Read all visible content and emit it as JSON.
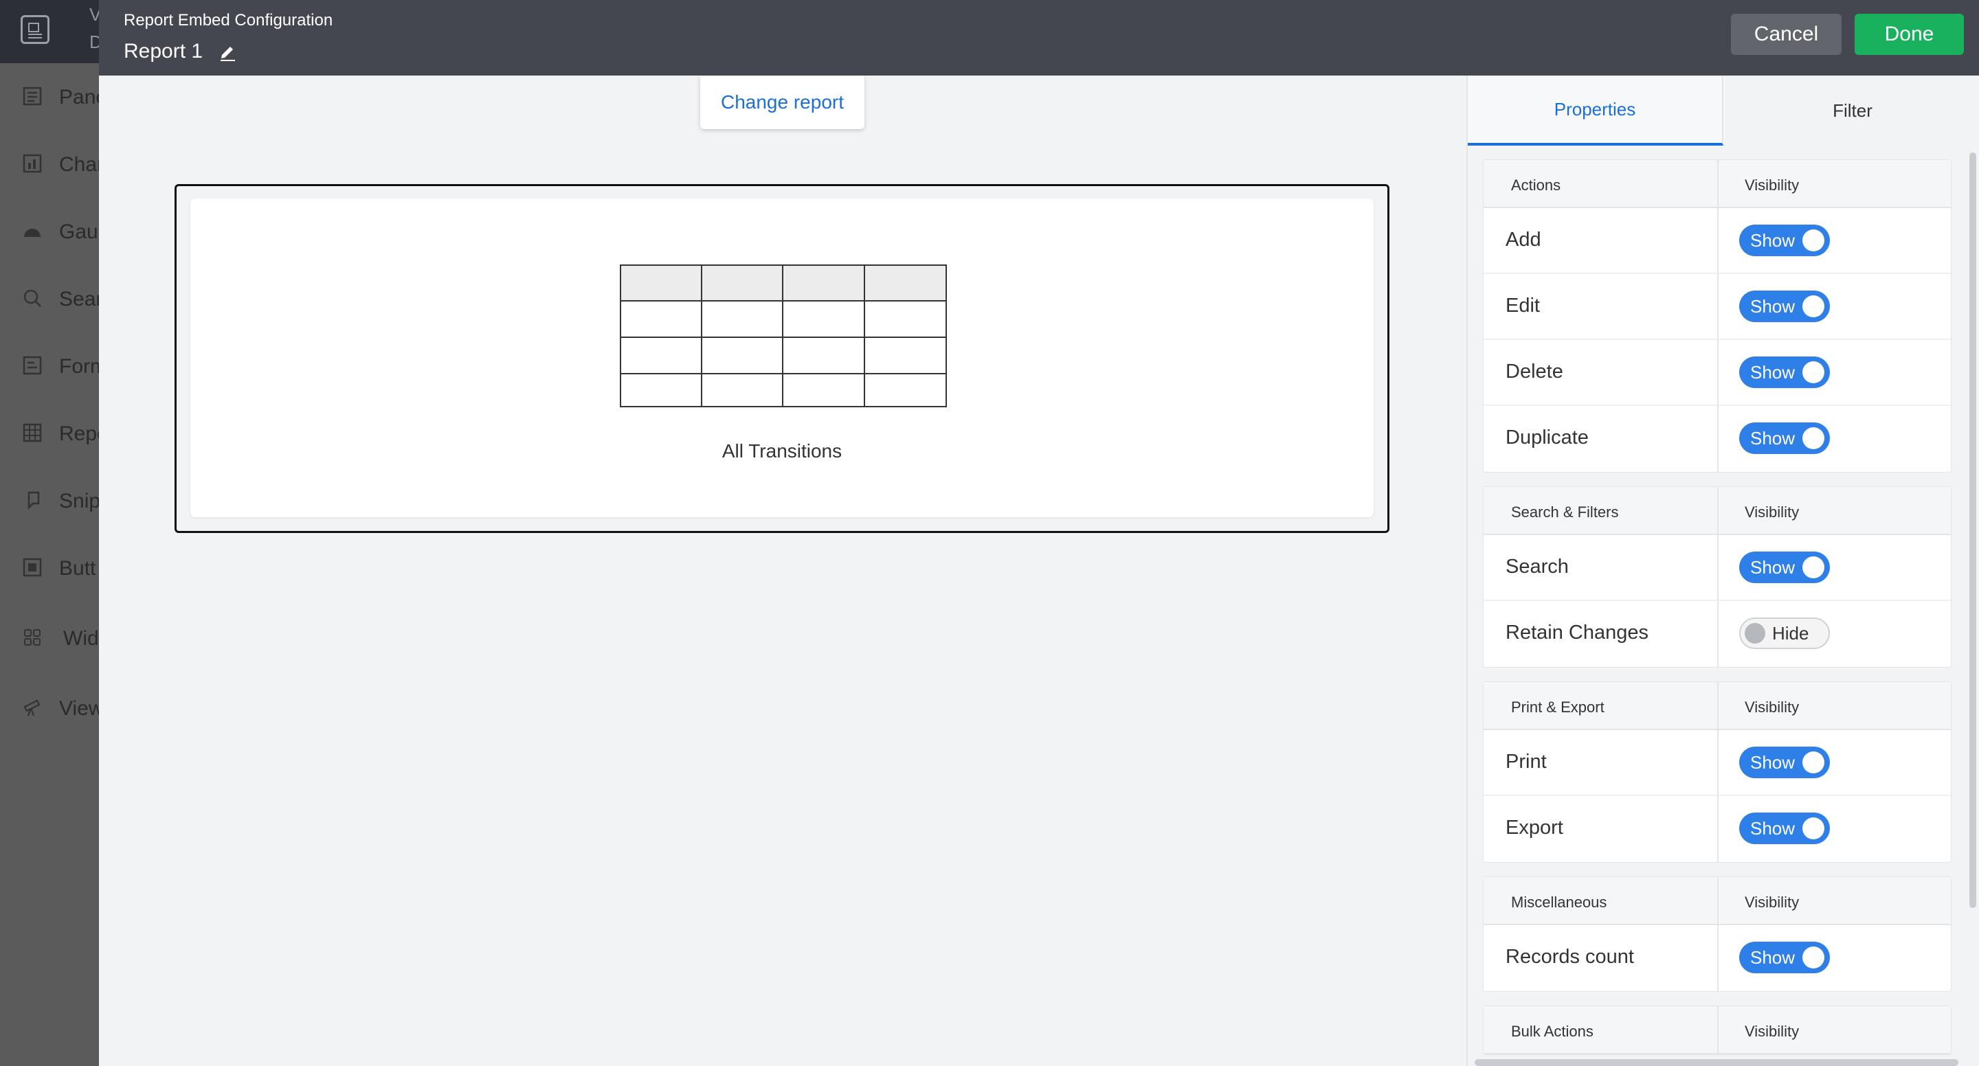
{
  "header": {
    "subtitle": "Report Embed Configuration",
    "title": "Report 1",
    "cancel_label": "Cancel",
    "done_label": "Done"
  },
  "left_sidebar": {
    "top_chars": [
      "V",
      "D"
    ],
    "items": [
      {
        "label": "Pane",
        "icon": "panel-icon"
      },
      {
        "label": "Char",
        "icon": "chart-icon"
      },
      {
        "label": "Gau",
        "icon": "gauge-icon"
      },
      {
        "label": "Sear",
        "icon": "search-icon"
      },
      {
        "label": "Form",
        "icon": "form-icon"
      },
      {
        "label": "Repo",
        "icon": "grid-icon"
      },
      {
        "label": "Snip",
        "icon": "snippet-icon"
      },
      {
        "label": "Butt",
        "icon": "button-icon"
      },
      {
        "label": "Wid",
        "icon": "widgets-icon"
      },
      {
        "label": "View",
        "icon": "telescope-icon"
      }
    ]
  },
  "canvas": {
    "change_report_label": "Change report",
    "report_name": "All Transitions"
  },
  "panel": {
    "tabs": [
      "Properties",
      "Filter"
    ],
    "sections": [
      {
        "title": "Actions",
        "visibility_label": "Visibility",
        "rows": [
          {
            "label": "Add",
            "state": "Show"
          },
          {
            "label": "Edit",
            "state": "Show"
          },
          {
            "label": "Delete",
            "state": "Show"
          },
          {
            "label": "Duplicate",
            "state": "Show"
          }
        ]
      },
      {
        "title": "Search & Filters",
        "visibility_label": "Visibility",
        "rows": [
          {
            "label": "Search",
            "state": "Show"
          },
          {
            "label": "Retain Changes",
            "state": "Hide"
          }
        ]
      },
      {
        "title": "Print & Export",
        "visibility_label": "Visibility",
        "rows": [
          {
            "label": "Print",
            "state": "Show"
          },
          {
            "label": "Export",
            "state": "Show"
          }
        ]
      },
      {
        "title": "Miscellaneous",
        "visibility_label": "Visibility",
        "rows": [
          {
            "label": "Records count",
            "state": "Show"
          }
        ]
      },
      {
        "title": "Bulk Actions",
        "visibility_label": "Visibility",
        "rows": []
      }
    ]
  },
  "colors": {
    "accent": "#2f7fe8",
    "done": "#1ab15e",
    "header_bg": "#44474f"
  }
}
